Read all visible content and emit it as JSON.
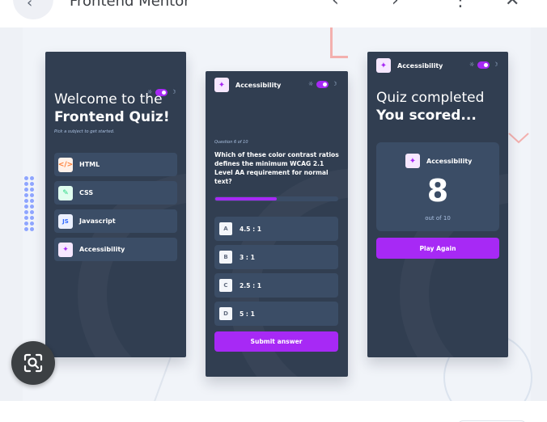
{
  "topbar": {
    "title": "Frontend Mentor",
    "back_icon": "back-arrow-icon",
    "icons": [
      "chevron-left-icon",
      "chevron-right-icon",
      "more-vertical-icon",
      "close-icon"
    ]
  },
  "colors": {
    "accent": "#a729f5",
    "panel": "#313e51",
    "card": "#3b4d66",
    "muted": "#abc1e1"
  },
  "screen1": {
    "title_line1": "Welcome to the",
    "title_line2": "Frontend Quiz!",
    "hint": "Pick a subject to get started.",
    "subjects": [
      {
        "label": "HTML",
        "icon": "code-icon",
        "glyph": "</>",
        "bg": "#fff1e9",
        "fg": "#ff7e35"
      },
      {
        "label": "CSS",
        "icon": "brush-icon",
        "glyph": "✎",
        "bg": "#e0fdef",
        "fg": "#2fd887"
      },
      {
        "label": "Javascript",
        "icon": "js-icon",
        "glyph": "JS",
        "bg": "#ebf0ff",
        "fg": "#306aff"
      },
      {
        "label": "Accessibility",
        "icon": "accessibility-icon",
        "glyph": "✦",
        "bg": "#f6e7ff",
        "fg": "#a729f5"
      }
    ]
  },
  "screen2": {
    "subject": "Accessibility",
    "question_number": "Question 6 of 10",
    "question": "Which of these color contrast ratios defines the minimum WCAG 2.1 Level AA requirement for normal text?",
    "progress": 0.5,
    "options": [
      {
        "letter": "A",
        "value": "4.5 : 1"
      },
      {
        "letter": "B",
        "value": "3 : 1"
      },
      {
        "letter": "C",
        "value": "2.5 : 1"
      },
      {
        "letter": "D",
        "value": "5 : 1"
      }
    ],
    "submit_label": "Submit answer"
  },
  "screen3": {
    "subject": "Accessibility",
    "title_line1": "Quiz completed",
    "title_line2": "You scored...",
    "score": "8",
    "out_of": "out of 10",
    "play_label": "Play Again"
  },
  "lens_icon": "visual-search-icon"
}
